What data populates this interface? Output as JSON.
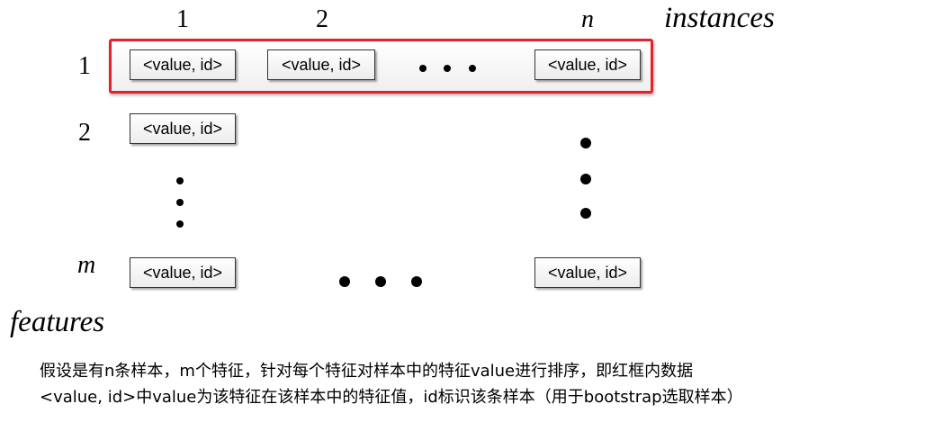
{
  "columns": {
    "col1": "1",
    "col2": "2",
    "coln": "n",
    "title": "instances"
  },
  "rows": {
    "row1": "1",
    "row2": "2",
    "rowm": "m",
    "title": "features"
  },
  "cell_text": "<value, id>",
  "highlight_color": "#e8202a",
  "caption": {
    "line1": "假设是有n条样本，m个特征，针对每个特征对样本中的特征value进行排序，即红框内数据",
    "line2": "<value, id>中value为该特征在该样本中的特征值，id标识该条样本（用于bootstrap选取样本）"
  }
}
